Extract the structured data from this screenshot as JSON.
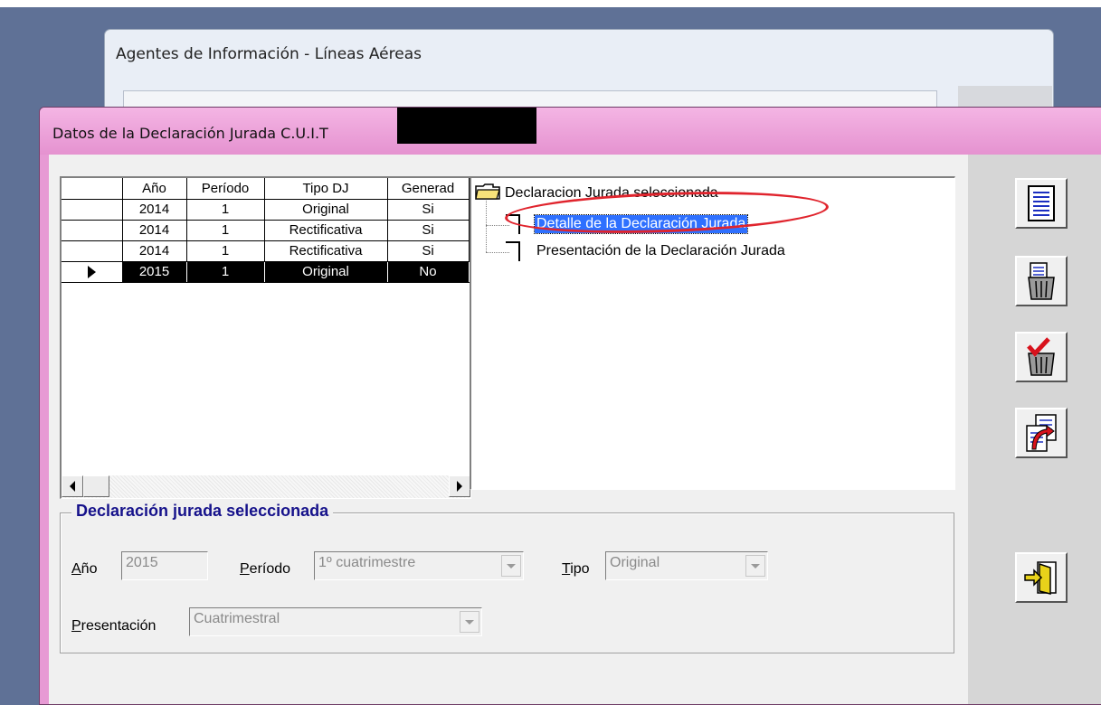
{
  "background_window": {
    "title": "Agentes de Información - Líneas Aéreas"
  },
  "dialog": {
    "title": "Datos de la Declaración Jurada C.U.I.T"
  },
  "grid": {
    "headers": [
      "Año",
      "Período",
      "Tipo DJ",
      "Generad"
    ],
    "rows": [
      {
        "anio": "2014",
        "periodo": "1",
        "tipo": "Original",
        "generada": "Si",
        "selected": false
      },
      {
        "anio": "2014",
        "periodo": "1",
        "tipo": "Rectificativa",
        "generada": "Si",
        "selected": false
      },
      {
        "anio": "2014",
        "periodo": "1",
        "tipo": "Rectificativa",
        "generada": "Si",
        "selected": false
      },
      {
        "anio": "2015",
        "periodo": "1",
        "tipo": "Original",
        "generada": "No",
        "selected": true
      }
    ]
  },
  "tree": {
    "root": "Declaracion Jurada seleccionada",
    "children": [
      "Detalle de la Declaración Jurada",
      "Presentación de la Declaración Jurada"
    ],
    "selected_index": 0
  },
  "toolbar": {
    "buttons": [
      "document-list-icon",
      "trash-icon",
      "trash-check-icon",
      "export-document-icon",
      "exit-door-icon"
    ]
  },
  "details": {
    "group_title": "Declaración jurada seleccionada",
    "anio_label_u": "A",
    "anio_label_rest": "ño",
    "anio_value": "2015",
    "periodo_label_u": "P",
    "periodo_label_rest": "eríodo",
    "periodo_value": "1º cuatrimestre",
    "tipo_label_u": "T",
    "tipo_label_rest": "ipo",
    "tipo_value": "Original",
    "presentacion_label_u": "P",
    "presentacion_label_rest": "resentación",
    "presentacion_value": "Cuatrimestral"
  },
  "colors": {
    "title_bar": "#e592d0",
    "selection": "#2e70ff",
    "annotation": "#e0242d",
    "group_title": "#16128b"
  }
}
